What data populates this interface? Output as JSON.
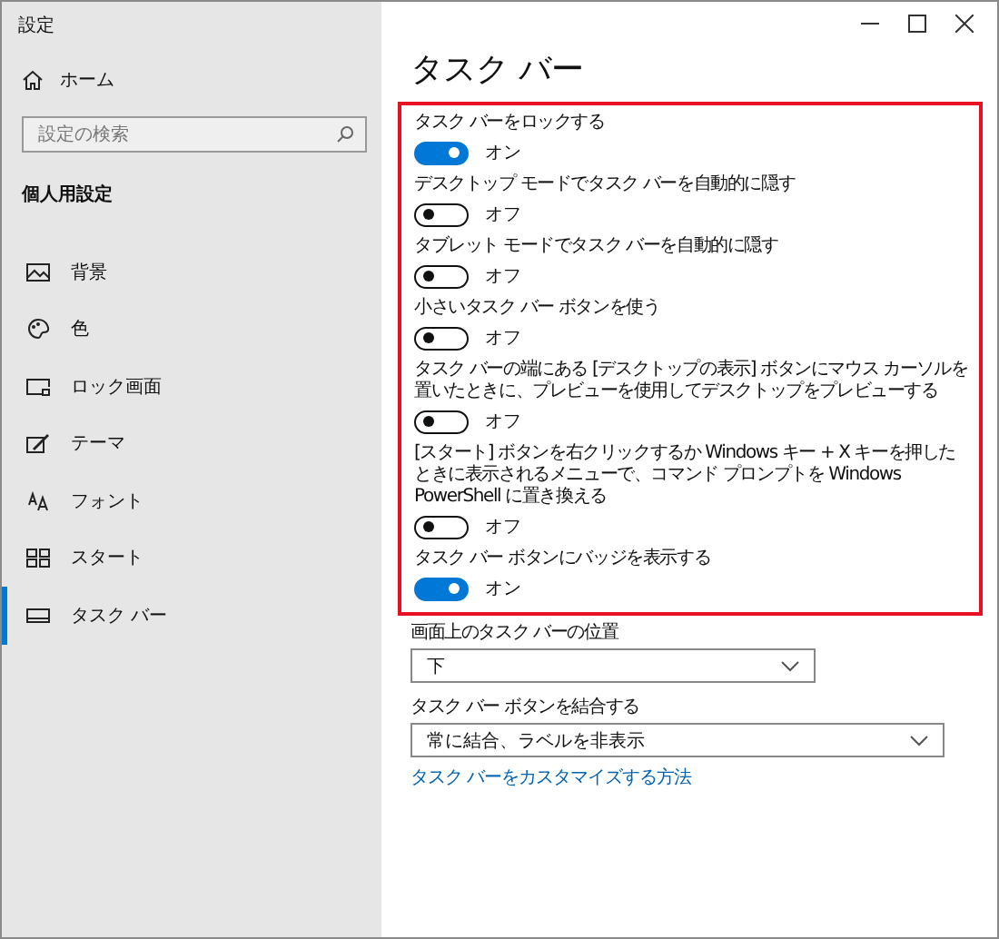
{
  "window": {
    "title": "設定"
  },
  "sidebar": {
    "home": "ホーム",
    "search": {
      "placeholder": "設定の検索"
    },
    "section": "個人用設定",
    "items": [
      {
        "label": "背景",
        "kind": "background",
        "selected": false
      },
      {
        "label": "色",
        "kind": "color",
        "selected": false
      },
      {
        "label": "ロック画面",
        "kind": "lock",
        "selected": false
      },
      {
        "label": "テーマ",
        "kind": "theme",
        "selected": false
      },
      {
        "label": "フォント",
        "kind": "font",
        "selected": false
      },
      {
        "label": "スタート",
        "kind": "start",
        "selected": false
      },
      {
        "label": "タスク バー",
        "kind": "taskbar",
        "selected": true
      }
    ]
  },
  "page": {
    "title": "タスク バー",
    "settings": [
      {
        "label": "タスク バーをロックする",
        "on": true,
        "state_text": "オン"
      },
      {
        "label": "デスクトップ モードでタスク バーを自動的に隠す",
        "on": false,
        "state_text": "オフ"
      },
      {
        "label": "タブレット モードでタスク バーを自動的に隠す",
        "on": false,
        "state_text": "オフ"
      },
      {
        "label": "小さいタスク バー ボタンを使う",
        "on": false,
        "state_text": "オフ"
      },
      {
        "label": "タスク バーの端にある [デスクトップの表示] ボタンにマウス カーソルを置いたときに、プレビューを使用してデスクトップをプレビューする",
        "on": false,
        "state_text": "オフ"
      },
      {
        "label": "[スタート] ボタンを右クリックするか Windows キー + X キーを押したときに表示されるメニューで、コマンド プロンプトを Windows PowerShell に置き換える",
        "on": false,
        "state_text": "オフ"
      },
      {
        "label": "タスク バー ボタンにバッジを表示する",
        "on": true,
        "state_text": "オン"
      }
    ],
    "dropdowns": [
      {
        "label": "画面上のタスク バーの位置",
        "value": "下"
      },
      {
        "label": "タスク バー ボタンを結合する",
        "value": "常に結合、ラベルを非表示"
      }
    ],
    "link": "タスク バーをカスタマイズする方法"
  }
}
